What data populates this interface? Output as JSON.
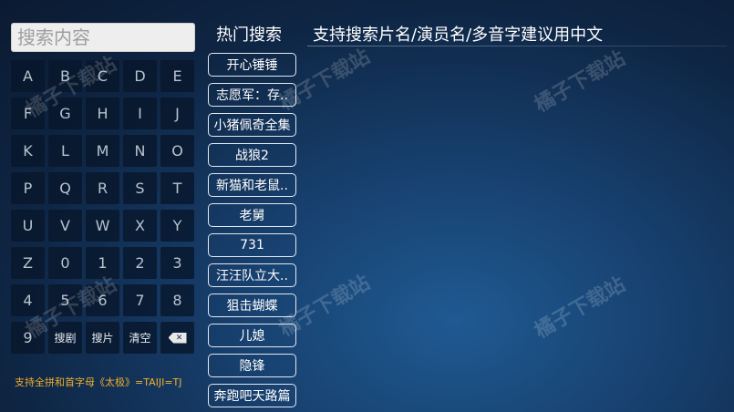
{
  "search": {
    "placeholder": "搜索内容"
  },
  "keyboard": {
    "rows": [
      [
        "A",
        "B",
        "C",
        "D",
        "E"
      ],
      [
        "F",
        "G",
        "H",
        "I",
        "J"
      ],
      [
        "K",
        "L",
        "M",
        "N",
        "O"
      ],
      [
        "P",
        "Q",
        "R",
        "S",
        "T"
      ],
      [
        "U",
        "V",
        "W",
        "X",
        "Y"
      ],
      [
        "Z",
        "0",
        "1",
        "2",
        "3"
      ],
      [
        "4",
        "5",
        "6",
        "7",
        "8"
      ],
      [
        "9",
        "搜剧",
        "搜片",
        "清空",
        ""
      ]
    ],
    "backspace_icon": "backspace-icon",
    "backspace_glyph": "✕"
  },
  "hint": "支持全拼和首字母《太极》=TAIJI=TJ",
  "hot": {
    "title": "热门搜索",
    "items": [
      "开心锤锤",
      "志愿军：存..",
      "小猪佩奇全集",
      "战狼2",
      "新猫和老鼠..",
      "老舅",
      "731",
      "汪汪队立大..",
      "狙击蝴蝶",
      "儿媳",
      "隐锋",
      "奔跑吧天路篇"
    ]
  },
  "header": {
    "tip": "支持搜索片名/演员名/多音字建议用中文"
  },
  "watermark": "橘子下载站",
  "colors": {
    "hint": "#f1b02c",
    "background": "#173f6d"
  }
}
